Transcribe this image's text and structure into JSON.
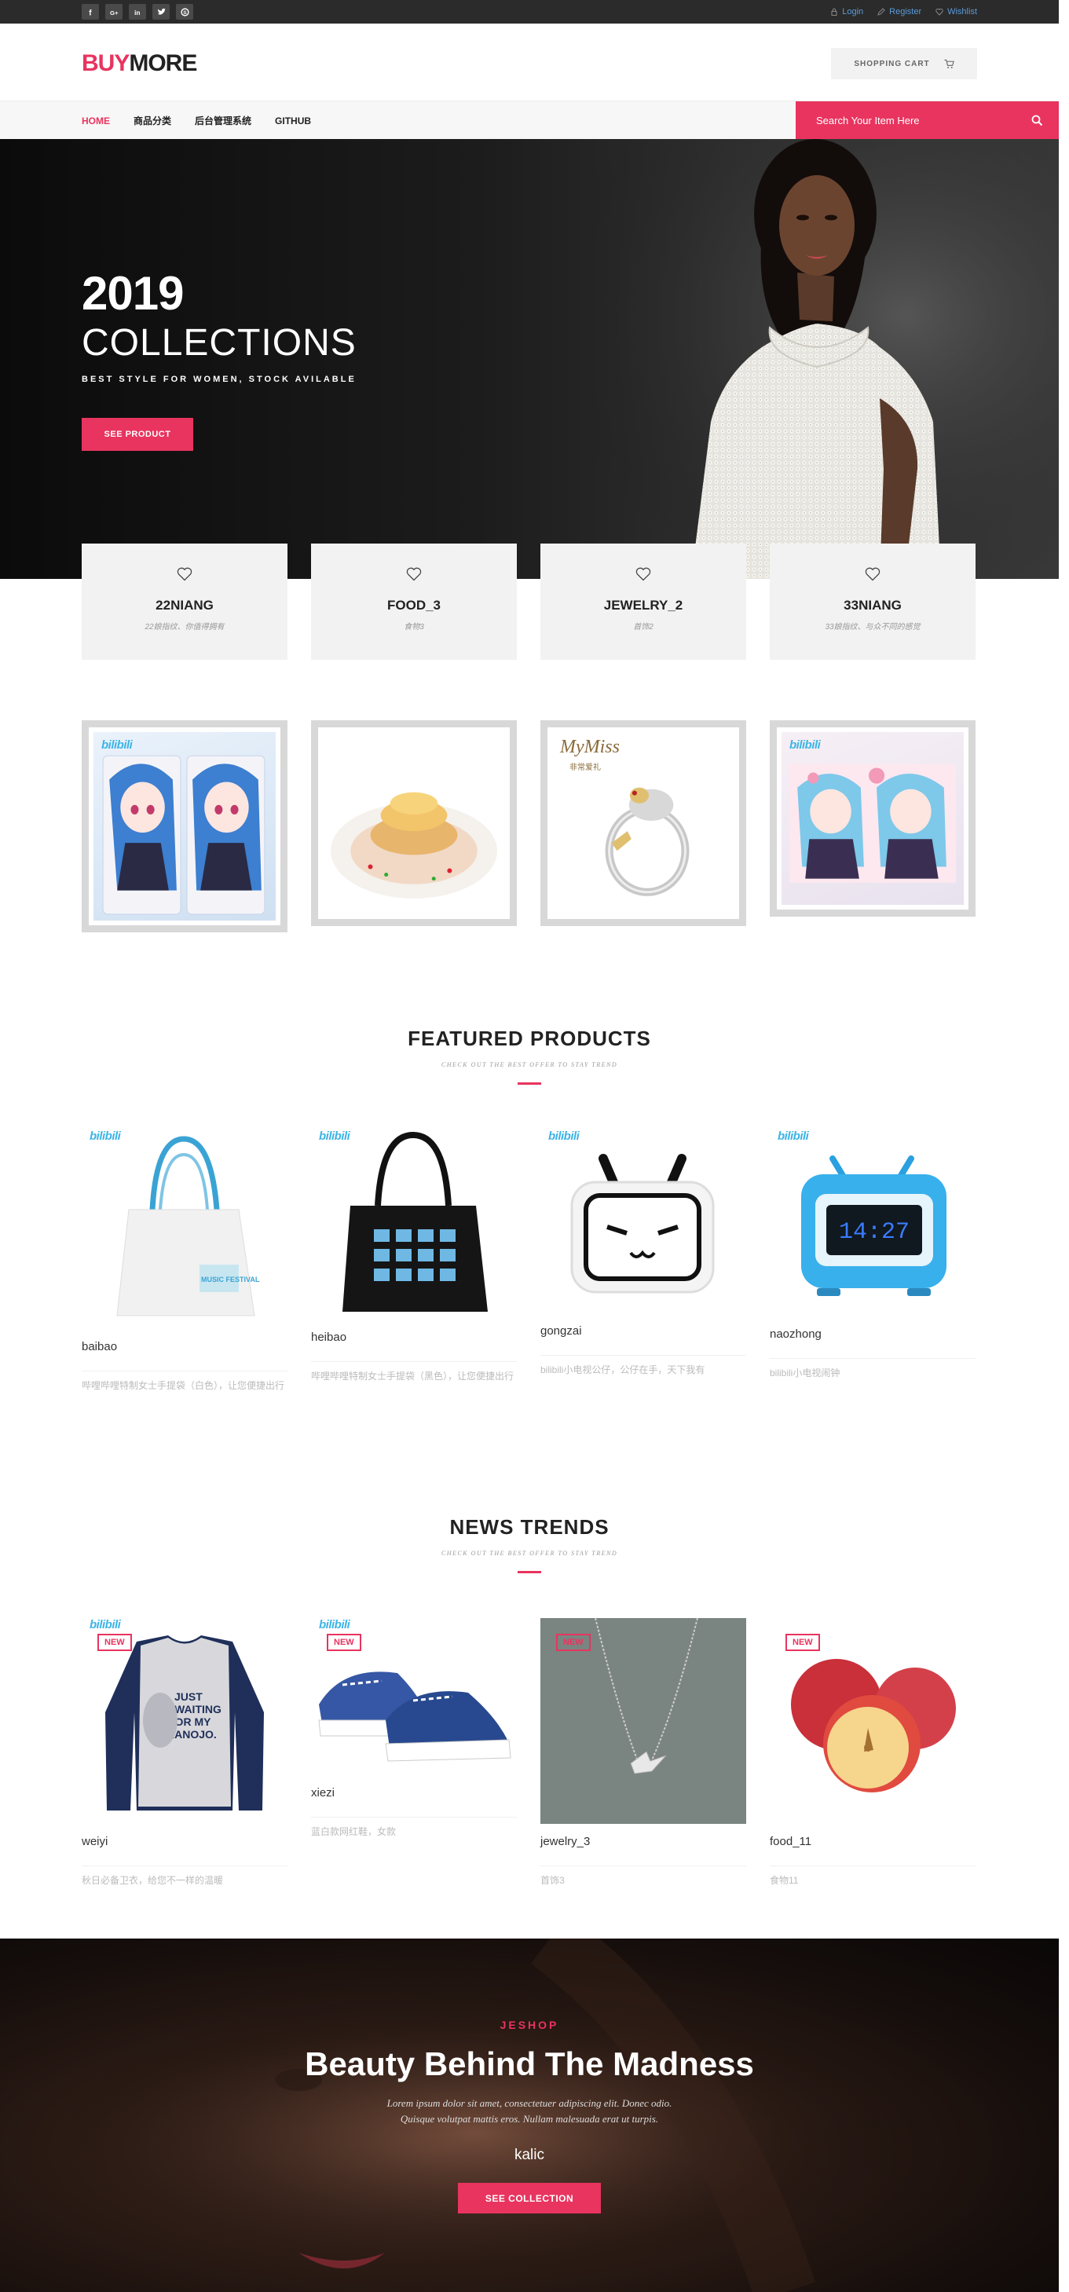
{
  "topbar": {
    "social_icons": [
      "facebook-icon",
      "google-plus-icon",
      "linkedin-icon",
      "twitter-icon",
      "skype-icon"
    ],
    "social_glyphs": [
      "f",
      "G+",
      "in",
      "t",
      "S"
    ],
    "login": "Login",
    "register": "Register",
    "wishlist": "Wishlist"
  },
  "header": {
    "logo_part1": "BUY",
    "logo_part2": "MORE",
    "cart_label": "SHOPPING CART"
  },
  "nav": {
    "items": [
      "HOME",
      "商品分类",
      "后台管理系统",
      "GITHUB"
    ],
    "search_placeholder": "Search Your Item Here"
  },
  "hero": {
    "year": "2019",
    "title": "COLLECTIONS",
    "subtitle": "BEST STYLE FOR WOMEN, STOCK AVILABLE",
    "button": "SEE PRODUCT"
  },
  "categories": [
    {
      "name": "22NIANG",
      "desc": "22娘指纹、你值得拥有"
    },
    {
      "name": "FOOD_3",
      "desc": "食物3"
    },
    {
      "name": "JEWELRY_2",
      "desc": "首饰2"
    },
    {
      "name": "33NIANG",
      "desc": "33娘指纹、与众不同的感觉"
    }
  ],
  "image_boxes": {
    "brand1": "bilibili",
    "brand_ring": "MyMiss",
    "brand_ring_sub": "非常爱礼"
  },
  "featured": {
    "title": "FEATURED PRODUCTS",
    "subtitle": "CHECK OUT THE BEST OFFER TO STAY TREND",
    "products": [
      {
        "name": "baibao",
        "desc": "哔哩哔哩特制女士手提袋（白色），让您便捷出行"
      },
      {
        "name": "heibao",
        "desc": "哔哩哔哩特制女士手提袋（黑色），让您便捷出行"
      },
      {
        "name": "gongzai",
        "desc": "bilibili小电视公仔，公仔在手，天下我有"
      },
      {
        "name": "naozhong",
        "desc": "bilibili小电视闹钟"
      }
    ],
    "clock_time": "14:27",
    "bag_text": "MUSIC FESTIVAL"
  },
  "news": {
    "title": "NEWS TRENDS",
    "subtitle": "CHECK OUT THE BEST OFFER TO STAY TREND",
    "tag": "NEW",
    "products": [
      {
        "name": "weiyi",
        "desc": "秋日必备卫衣，给您不一样的温暖"
      },
      {
        "name": "xiezi",
        "desc": "蓝白款网红鞋，女款"
      },
      {
        "name": "jewelry_3",
        "desc": "首饰3"
      },
      {
        "name": "food_11",
        "desc": "食物11"
      }
    ],
    "shirt_text": "JUST WAITING FOR MY KANOJO."
  },
  "banner": {
    "pretitle": "JESHOP",
    "title": "Beauty Behind The Madness",
    "line1": "Lorem ipsum dolor sit amet, consectetuer adipiscing elit. Donec odio.",
    "line2": "Quisque volutpat mattis eros. Nullam malesuada erat ut turpis.",
    "name": "kalic",
    "button": "SEE COLLECTION"
  },
  "colors": {
    "accent": "#e8345f",
    "topbar": "#2b2b2b",
    "link": "#5a9bd8",
    "bilibili": "#3db4e6"
  }
}
